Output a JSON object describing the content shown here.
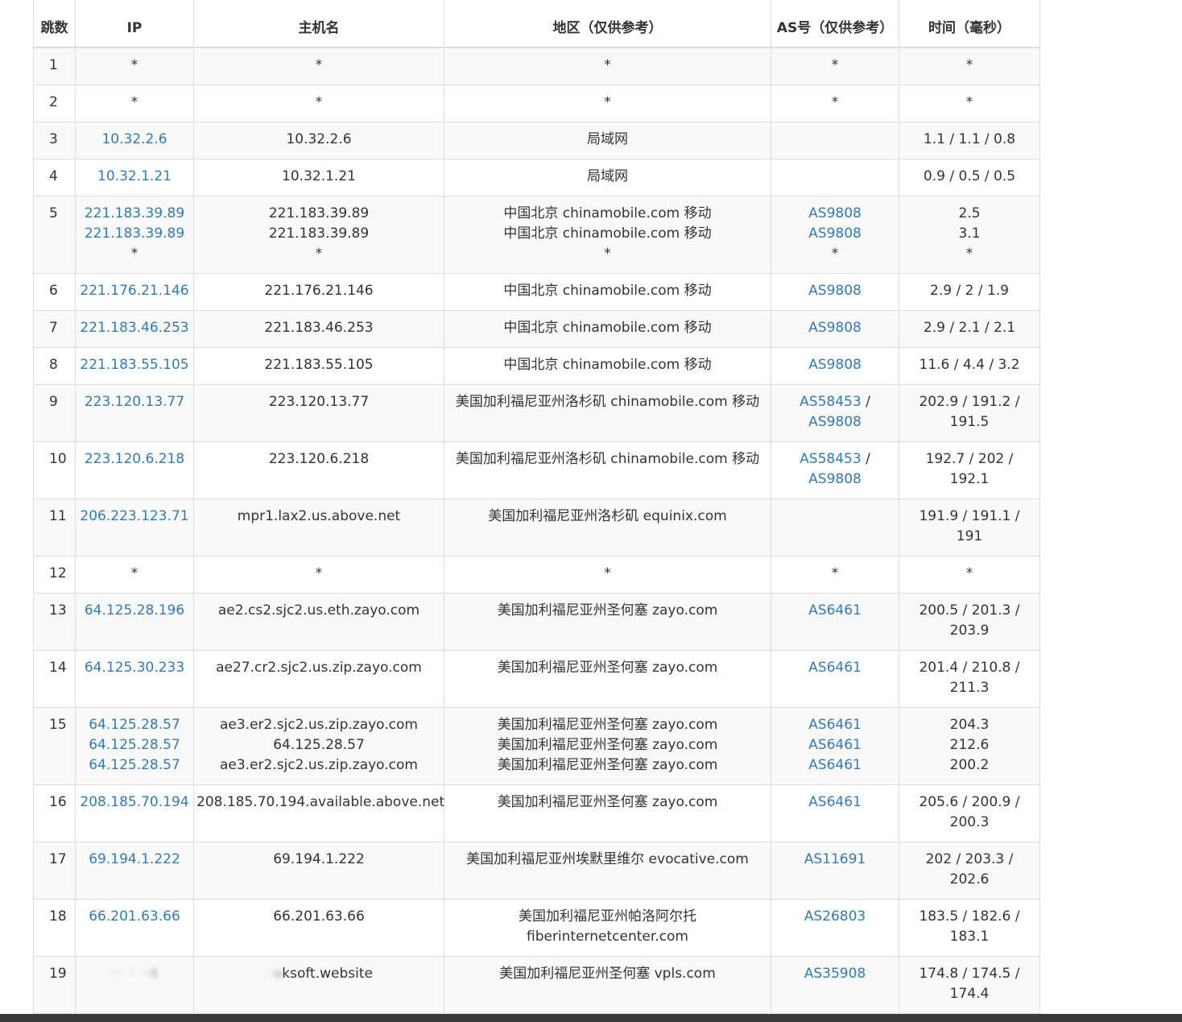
{
  "headers": [
    "跳数",
    "IP",
    "主机名",
    "地区（仅供参考）",
    "AS号（仅供参考）",
    "时间（毫秒）"
  ],
  "rows": [
    {
      "hop": "1",
      "ip": [
        "*"
      ],
      "host": [
        "*"
      ],
      "region": [
        "*"
      ],
      "as": [
        "*"
      ],
      "time": [
        "*"
      ]
    },
    {
      "hop": "2",
      "ip": [
        "*"
      ],
      "host": [
        "*"
      ],
      "region": [
        "*"
      ],
      "as": [
        "*"
      ],
      "time": [
        "*"
      ]
    },
    {
      "hop": "3",
      "ip": [
        "10.32.2.6"
      ],
      "host": [
        "10.32.2.6"
      ],
      "region": [
        "局域网"
      ],
      "as": [],
      "time": [
        "1.1 / 1.1 / 0.8"
      ]
    },
    {
      "hop": "4",
      "ip": [
        "10.32.1.21"
      ],
      "host": [
        "10.32.1.21"
      ],
      "region": [
        "局域网"
      ],
      "as": [],
      "time": [
        "0.9 / 0.5 / 0.5"
      ]
    },
    {
      "hop": "5",
      "ip": [
        "221.183.39.89",
        "221.183.39.89",
        "*"
      ],
      "host": [
        "221.183.39.89",
        "221.183.39.89",
        "*"
      ],
      "region": [
        "中国北京 chinamobile.com 移动",
        "中国北京 chinamobile.com 移动",
        "*"
      ],
      "as": [
        "AS9808",
        "AS9808",
        "*"
      ],
      "time": [
        "2.5",
        "3.1",
        "*"
      ]
    },
    {
      "hop": "6",
      "ip": [
        "221.176.21.146"
      ],
      "host": [
        "221.176.21.146"
      ],
      "region": [
        "中国北京 chinamobile.com 移动"
      ],
      "as": [
        "AS9808"
      ],
      "time": [
        "2.9 / 2 / 1.9"
      ]
    },
    {
      "hop": "7",
      "ip": [
        "221.183.46.253"
      ],
      "host": [
        "221.183.46.253"
      ],
      "region": [
        "中国北京 chinamobile.com 移动"
      ],
      "as": [
        "AS9808"
      ],
      "time": [
        "2.9 / 2.1 / 2.1"
      ]
    },
    {
      "hop": "8",
      "ip": [
        "221.183.55.105"
      ],
      "host": [
        "221.183.55.105"
      ],
      "region": [
        "中国北京 chinamobile.com 移动"
      ],
      "as": [
        "AS9808"
      ],
      "time": [
        "11.6 / 4.4 / 3.2"
      ]
    },
    {
      "hop": "9",
      "ip": [
        "223.120.13.77"
      ],
      "host": [
        "223.120.13.77"
      ],
      "region": [
        "美国加利福尼亚州洛杉矶 chinamobile.com 移动"
      ],
      "as_pair": [
        "AS58453",
        "AS9808"
      ],
      "time": [
        "202.9 / 191.2 /",
        "191.5"
      ]
    },
    {
      "hop": "10",
      "ip": [
        "223.120.6.218"
      ],
      "host": [
        "223.120.6.218"
      ],
      "region": [
        "美国加利福尼亚州洛杉矶 chinamobile.com 移动"
      ],
      "as_pair": [
        "AS58453",
        "AS9808"
      ],
      "time": [
        "192.7 / 202 /",
        "192.1"
      ]
    },
    {
      "hop": "11",
      "ip": [
        "206.223.123.71"
      ],
      "host": [
        "mpr1.lax2.us.above.net"
      ],
      "region": [
        "美国加利福尼亚州洛杉矶 equinix.com"
      ],
      "as": [],
      "time": [
        "191.9 / 191.1 /",
        "191"
      ]
    },
    {
      "hop": "12",
      "ip": [
        "*"
      ],
      "host": [
        "*"
      ],
      "region": [
        "*"
      ],
      "as": [
        "*"
      ],
      "time": [
        "*"
      ]
    },
    {
      "hop": "13",
      "ip": [
        "64.125.28.196"
      ],
      "host": [
        "ae2.cs2.sjc2.us.eth.zayo.com"
      ],
      "region": [
        "美国加利福尼亚州圣何塞 zayo.com"
      ],
      "as": [
        "AS6461"
      ],
      "time": [
        "200.5 / 201.3 /",
        "203.9"
      ]
    },
    {
      "hop": "14",
      "ip": [
        "64.125.30.233"
      ],
      "host": [
        "ae27.cr2.sjc2.us.zip.zayo.com"
      ],
      "region": [
        "美国加利福尼亚州圣何塞 zayo.com"
      ],
      "as": [
        "AS6461"
      ],
      "time": [
        "201.4 / 210.8 /",
        "211.3"
      ]
    },
    {
      "hop": "15",
      "ip": [
        "64.125.28.57",
        "64.125.28.57",
        "64.125.28.57"
      ],
      "host": [
        "ae3.er2.sjc2.us.zip.zayo.com",
        "64.125.28.57",
        "ae3.er2.sjc2.us.zip.zayo.com"
      ],
      "region": [
        "美国加利福尼亚州圣何塞 zayo.com",
        "美国加利福尼亚州圣何塞 zayo.com",
        "美国加利福尼亚州圣何塞 zayo.com"
      ],
      "as": [
        "AS6461",
        "AS6461",
        "AS6461"
      ],
      "time": [
        "204.3",
        "212.6",
        "200.2"
      ]
    },
    {
      "hop": "16",
      "ip": [
        "208.185.70.194"
      ],
      "host": [
        "208.185.70.194.available.above.net"
      ],
      "region": [
        "美国加利福尼亚州圣何塞 zayo.com"
      ],
      "as": [
        "AS6461"
      ],
      "time": [
        "205.6 / 200.9 /",
        "200.3"
      ]
    },
    {
      "hop": "17",
      "ip": [
        "69.194.1.222"
      ],
      "host": [
        "69.194.1.222"
      ],
      "region": [
        "美国加利福尼亚州埃默里维尔 evocative.com"
      ],
      "as": [
        "AS11691"
      ],
      "time": [
        "202 / 203.3 /",
        "202.6"
      ]
    },
    {
      "hop": "18",
      "ip": [
        "66.201.63.66"
      ],
      "host": [
        "66.201.63.66"
      ],
      "region": [
        "美国加利福尼亚州帕洛阿尔托",
        "fiberinternetcenter.com"
      ],
      "as": [
        "AS26803"
      ],
      "time": [
        "183.5 / 182.6 /",
        "183.1"
      ]
    },
    {
      "hop": "19",
      "ip_blurred": "··· ·· ··4",
      "host": [
        "ksoft.website"
      ],
      "host_prefix_blurred": "··a",
      "region": [
        "美国加利福尼亚州圣何塞 vpls.com"
      ],
      "as": [
        "AS35908"
      ],
      "time": [
        "174.8 / 174.5 /",
        "174.4"
      ]
    }
  ],
  "row_heights": [
    46,
    46,
    46,
    46,
    96,
    46,
    46,
    46,
    71,
    71,
    71,
    46,
    71,
    71,
    96,
    71,
    71,
    71,
    71
  ]
}
